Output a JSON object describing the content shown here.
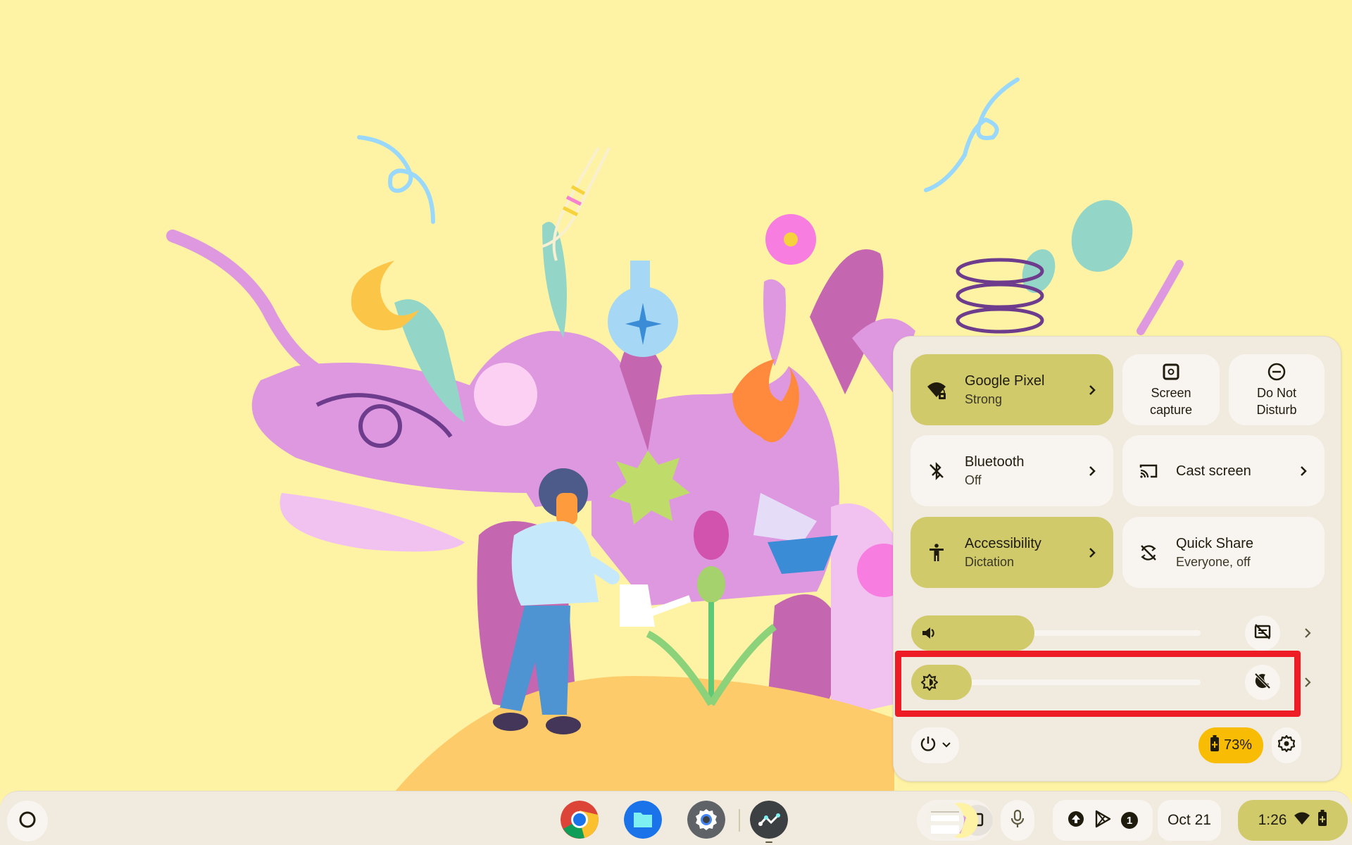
{
  "quick_settings": {
    "wifi": {
      "label": "Google Pixel",
      "sub": "Strong",
      "state": "on",
      "icon": "wifi-locked-icon"
    },
    "screen_capture": {
      "label_line1": "Screen",
      "label_line2": "capture",
      "icon": "screen-capture-icon"
    },
    "do_not_disturb": {
      "label_line1": "Do Not",
      "label_line2": "Disturb",
      "icon": "do-not-disturb-icon"
    },
    "bluetooth": {
      "label": "Bluetooth",
      "sub": "Off",
      "state": "off",
      "icon": "bluetooth-disabled-icon"
    },
    "cast": {
      "label": "Cast screen",
      "icon": "cast-icon"
    },
    "accessibility": {
      "label": "Accessibility",
      "sub": "Dictation",
      "state": "on",
      "icon": "accessibility-icon"
    },
    "quick_share": {
      "label": "Quick Share",
      "sub": "Everyone, off",
      "icon": "quick-share-off-icon"
    },
    "volume": {
      "level_percent": 54,
      "icon": "volume-icon",
      "toggle_icon": "live-caption-off-icon"
    },
    "brightness": {
      "level_percent": 20,
      "icon": "brightness-auto-icon",
      "toggle_icon": "night-light-off-icon"
    },
    "battery": {
      "label": "73%",
      "level_percent": 73,
      "icon": "battery-charging-icon"
    },
    "power_icon": "power-icon",
    "settings_icon": "gear-icon"
  },
  "shelf": {
    "launcher_icon": "launcher-circle-icon",
    "apps": [
      {
        "name": "Chrome",
        "icon": "chrome-icon"
      },
      {
        "name": "Files",
        "icon": "files-icon"
      },
      {
        "name": "Settings",
        "icon": "settings-app-icon"
      },
      {
        "name": "Stocks",
        "icon": "trend-chart-icon",
        "running": true
      }
    ],
    "tray": {
      "notification_count": "1",
      "date": "Oct 21",
      "time": "1:26"
    }
  },
  "highlight": {
    "color": "#EE1C25",
    "target": "brightness-slider-row"
  },
  "colors": {
    "wallpaper_bg": "#FEF3A4",
    "panel_bg": "#F1EBDF",
    "pod_active": "#D0CA6B",
    "pod_inactive": "#F8F4F0",
    "battery": "#F9BC05"
  }
}
